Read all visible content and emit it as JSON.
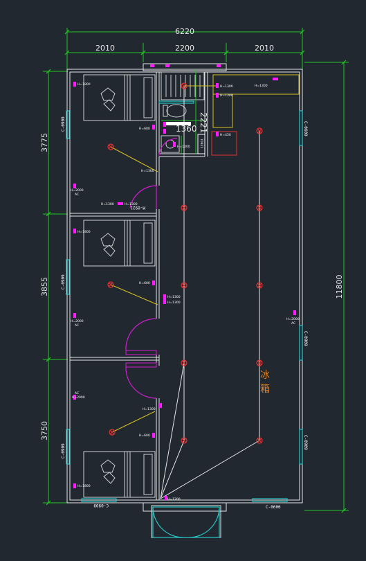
{
  "dimensions": {
    "total_width": "6220",
    "width_left": "2010",
    "width_mid": "2200",
    "width_right": "2010",
    "total_height": "11800",
    "height_top": "3775",
    "height_mid": "3855",
    "height_bottom": "3750",
    "bath_height": "2221",
    "bath_width": "1360"
  },
  "labels": {
    "fridge": "冰箱",
    "outlet_1800": "H=1800",
    "outlet_1300": "H=1300",
    "outlet_2000": "H=2000",
    "outlet_600": "H=600",
    "outlet_450": "H=450",
    "outlet_1200": "H=1200",
    "ac": "AC",
    "window_c0909": "C-0909",
    "window_c0609": "C-0609",
    "window_c0606": "C-0606",
    "window_c0909b": "C-0909",
    "window_c0909c": "C-0909",
    "window_c0909d": "C-0909",
    "window_c0606b": "C-0606",
    "door_label": "M-0921",
    "heater": "T0921"
  },
  "colors": {
    "background": "#212830",
    "wall": "#e6e6e6",
    "dimension": "#23c823",
    "outlet": "#ff1aff",
    "light": "#e63232",
    "wire": "#e6e6e6",
    "switch_wire": "#d8c020",
    "door_arc": "#d21ed2",
    "window": "#28c8c8",
    "fridge_text": "#d9822b"
  }
}
